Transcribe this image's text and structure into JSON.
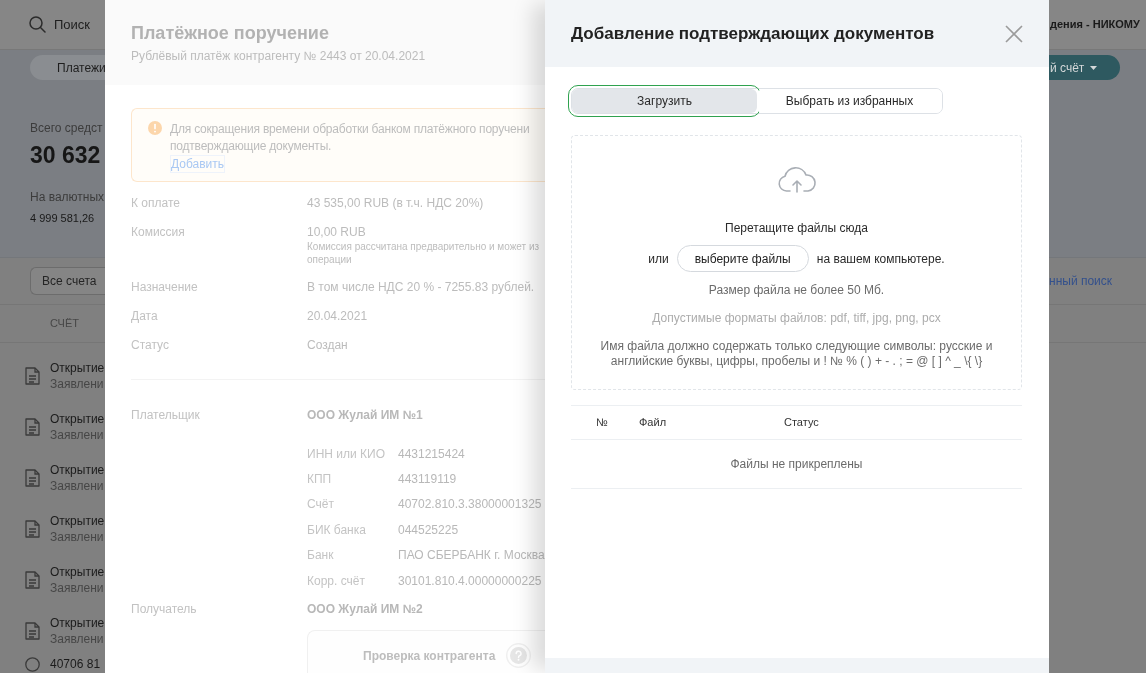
{
  "background_app": {
    "search_label": "Поиск",
    "organization": "дения - НИКОМУ",
    "nav_tab": "Платежи",
    "new_account_button": "й счёт",
    "total_label": "Всего средст",
    "total_amount": "30 632",
    "currency_label": "На валютных",
    "currency_amount": "4 999 581,26",
    "account_filter": "Все счета",
    "advanced_search_link": "нный поиск",
    "column_header": "СЧЁТ",
    "rows": [
      {
        "kind": "document",
        "title": "Открытие",
        "subtitle": "Заявлени"
      },
      {
        "kind": "document",
        "title": "Открытие",
        "subtitle": "Заявлени"
      },
      {
        "kind": "document",
        "title": "Открытие",
        "subtitle": "Заявлени"
      },
      {
        "kind": "document",
        "title": "Открытие",
        "subtitle": "Заявлени"
      },
      {
        "kind": "document",
        "title": "Открытие",
        "subtitle": "Заявлени"
      },
      {
        "kind": "document",
        "title": "Открытие",
        "subtitle": "Заявлени"
      },
      {
        "kind": "account",
        "title": "40706 81"
      }
    ]
  },
  "payment_order": {
    "title": "Платёжное поручение",
    "subtitle": "Рублёвый платёж контрагенту № 2443 от 20.04.2021",
    "notice": {
      "text": "Для сокращения времени обработки банком платёжного поручени\nподтверждающие документы.",
      "link": "Добавить"
    },
    "details": [
      {
        "label": "К оплате",
        "value": "43 535,00 RUB (в т.ч. НДС 20%)"
      },
      {
        "label": "Комиссия",
        "value": "10,00 RUB",
        "note": "Комиссия рассчитана предварительно и может из\nоперации"
      },
      {
        "label": "Назначение",
        "value": "В том числе НДС 20 % - 7255.83 рублей."
      },
      {
        "label": "Дата",
        "value": "20.04.2021"
      },
      {
        "label": "Статус",
        "value": "Создан"
      }
    ],
    "payer": {
      "label": "Плательщик",
      "name": "ООО Жулай ИМ №1",
      "requisites": [
        {
          "label": "ИНН или КИО",
          "value": "4431215424"
        },
        {
          "label": "КПП",
          "value": "443119119"
        },
        {
          "label": "Счёт",
          "value": "40702.810.3.38000001325"
        },
        {
          "label": "БИК банка",
          "value": "044525225"
        },
        {
          "label": "Банк",
          "value": "ПАО СБЕРБАНК г. Москва"
        },
        {
          "label": "Корр. счёт",
          "value": "30101.810.4.00000000225"
        }
      ]
    },
    "recipient": {
      "label": "Получатель",
      "name": "ООО Жулай ИМ №2"
    },
    "counterparty_check": "Проверка контрагента"
  },
  "modal": {
    "title": "Добавление подтверждающих документов",
    "tabs": [
      {
        "label": "Загрузить",
        "selected": true
      },
      {
        "label": "Выбрать из избранных",
        "selected": false
      }
    ],
    "dropzone": {
      "drag_text": "Перетащите файлы сюда",
      "or_text": "или",
      "choose_button": "выберите файлы",
      "after_text": "на вашем компьютере.",
      "size_hint": "Размер файла не более 50 Мб.",
      "formats_hint": "Допустимые форматы файлов: pdf, tiff, jpg, png, pcx",
      "name_hint": "Имя файла должно содержать только следующие символы: русские и\nанглийские буквы, цифры, пробелы и ! № % ( ) + - . ; = @ [ ] ^ _ \\{ \\}"
    },
    "files_table": {
      "columns": [
        "№",
        "Файл",
        "Статус"
      ],
      "empty_text": "Файлы не прикреплены"
    }
  }
}
